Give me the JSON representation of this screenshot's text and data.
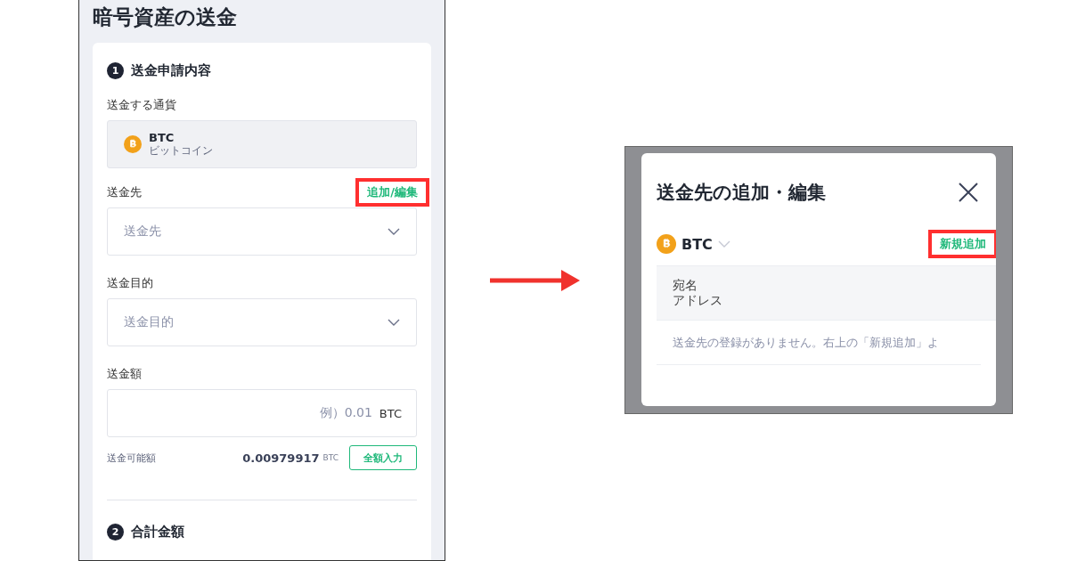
{
  "send_form": {
    "title": "暗号資産の送金",
    "section_1": {
      "number": "1",
      "title": "送金申請内容"
    },
    "currency": {
      "label": "送金する通貨",
      "code": "BTC",
      "name": "ビットコイン"
    },
    "destination": {
      "label": "送金先",
      "link": "追加/編集",
      "link_highlighted": true,
      "placeholder": "送金先"
    },
    "purpose": {
      "label": "送金目的",
      "placeholder": "送金目的"
    },
    "amount": {
      "label": "送金額",
      "placeholder": "例）0.01",
      "unit": "BTC"
    },
    "available": {
      "label": "送金可能額",
      "value": "0.00979917",
      "unit": "BTC",
      "button": "全額入力"
    },
    "section_2": {
      "number": "2",
      "title": "合計金額"
    }
  },
  "dialog": {
    "title": "送金先の追加・編集",
    "currency": "BTC",
    "add_link": "新規追加",
    "add_link_highlighted": true,
    "table": {
      "columns": [
        {
          "line_1": "宛名",
          "line_2": "アドレス"
        }
      ],
      "empty_message": "送金先の登録がありません。右上の「新規追加」よ"
    }
  }
}
